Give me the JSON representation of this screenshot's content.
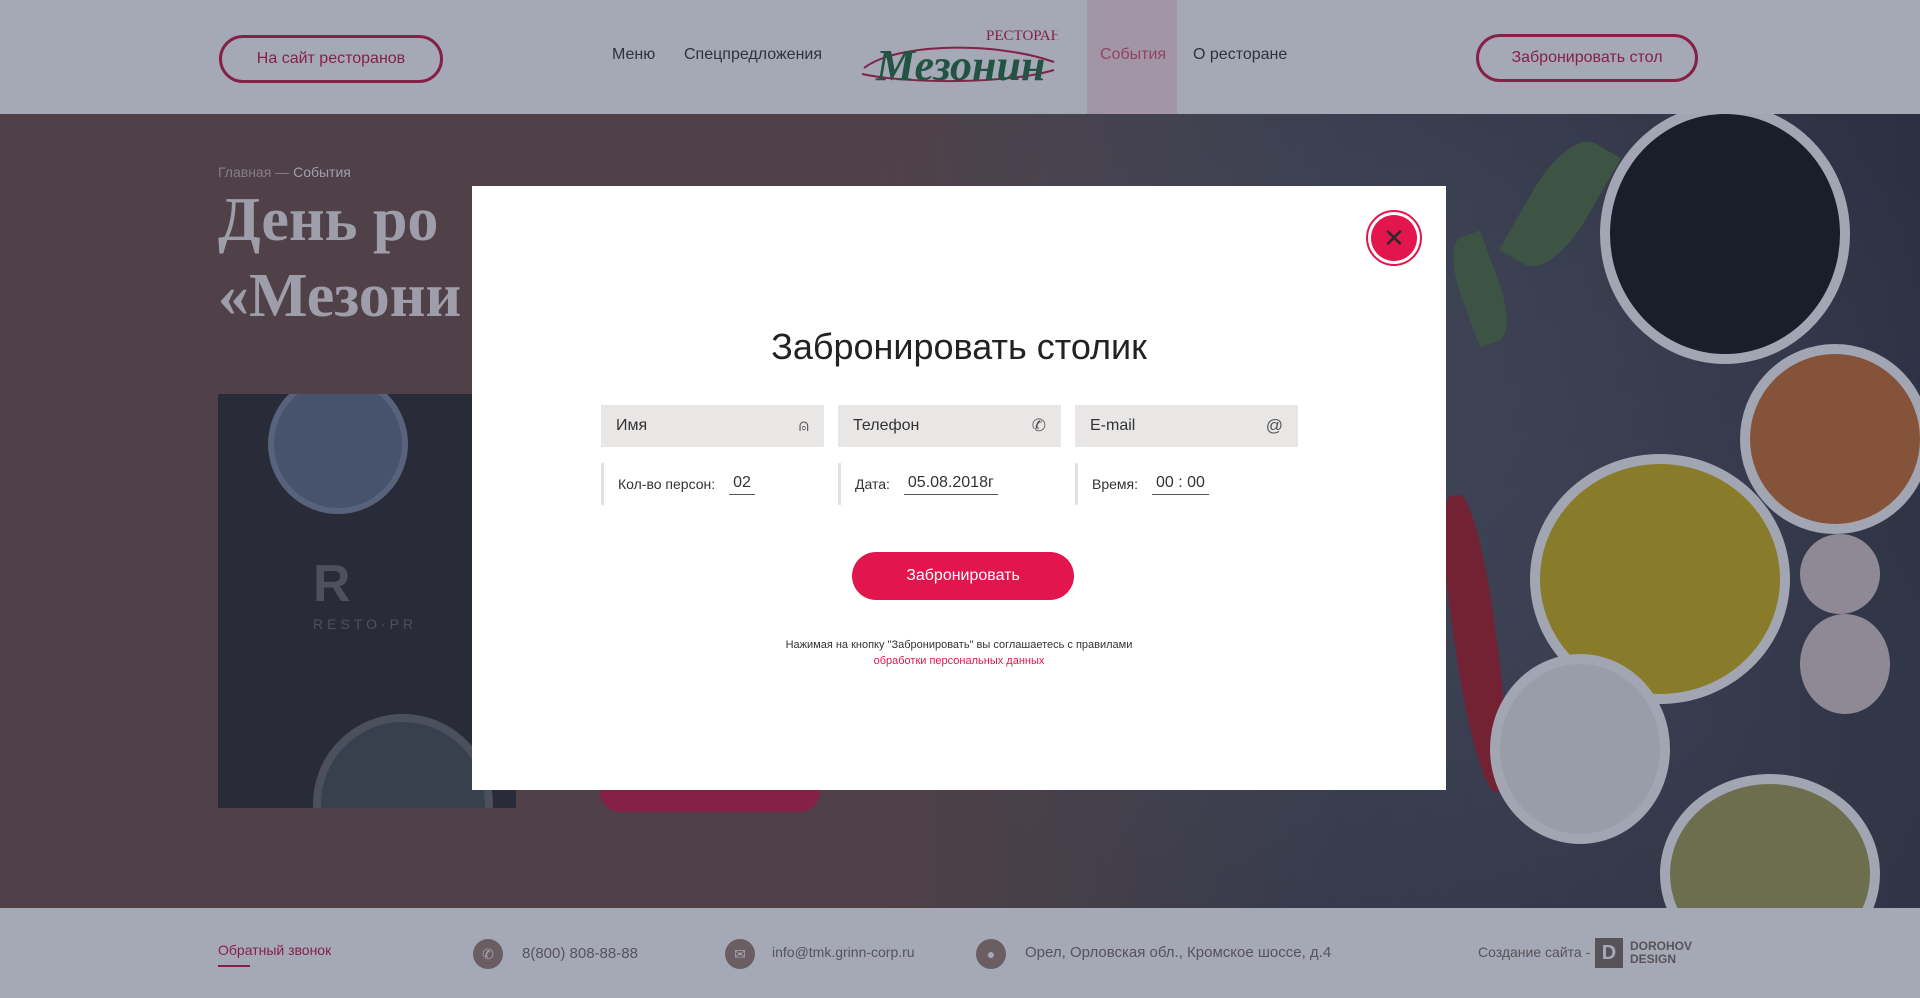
{
  "header": {
    "site_button": "На сайт ресторанов",
    "nav": [
      "Меню",
      "Спецпредложения",
      "События",
      "О ресторане"
    ],
    "logo_top": "РЕСТОРАН",
    "logo_main": "Мезонин",
    "book_button": "Забронировать стол"
  },
  "hero": {
    "breadcrumb_home": "Главная",
    "breadcrumb_sep": " — ",
    "breadcrumb_current": "События",
    "title_line1": "День ро",
    "title_line2": "«Мезони",
    "photo_mark": "R",
    "photo_text": "RESTO·PR"
  },
  "modal": {
    "close": "✕",
    "title": "Забронировать столик",
    "name_placeholder": "Имя",
    "phone_placeholder": "Телефон",
    "email_placeholder": "E-mail",
    "persons_label": "Кол-во персон:",
    "persons_value": "02",
    "date_label": "Дата:",
    "date_value": "05.08.2018г",
    "time_label": "Время:",
    "time_value": "00 : 00",
    "submit": "Забронировать",
    "note_text": "Нажимая на кнопку \"Забронировать\" вы соглашаетесь с правилами",
    "note_link": "обработки персональных данных"
  },
  "footer": {
    "callback": "Обратный звонок",
    "phone": "8(800) 808-88-88",
    "email": "info@tmk.grinn-corp.ru",
    "address": "Орел, Орловская обл., Кромское шоссе, д.4",
    "credit": "Создание сайта -",
    "credit_logo_letter": "D",
    "credit_logo_line1": "DOROHOV",
    "credit_logo_line2": "DESIGN"
  },
  "colors": {
    "accent": "#e3154d",
    "brand_red": "#c8133f",
    "logo_green": "#1f6b3a"
  }
}
